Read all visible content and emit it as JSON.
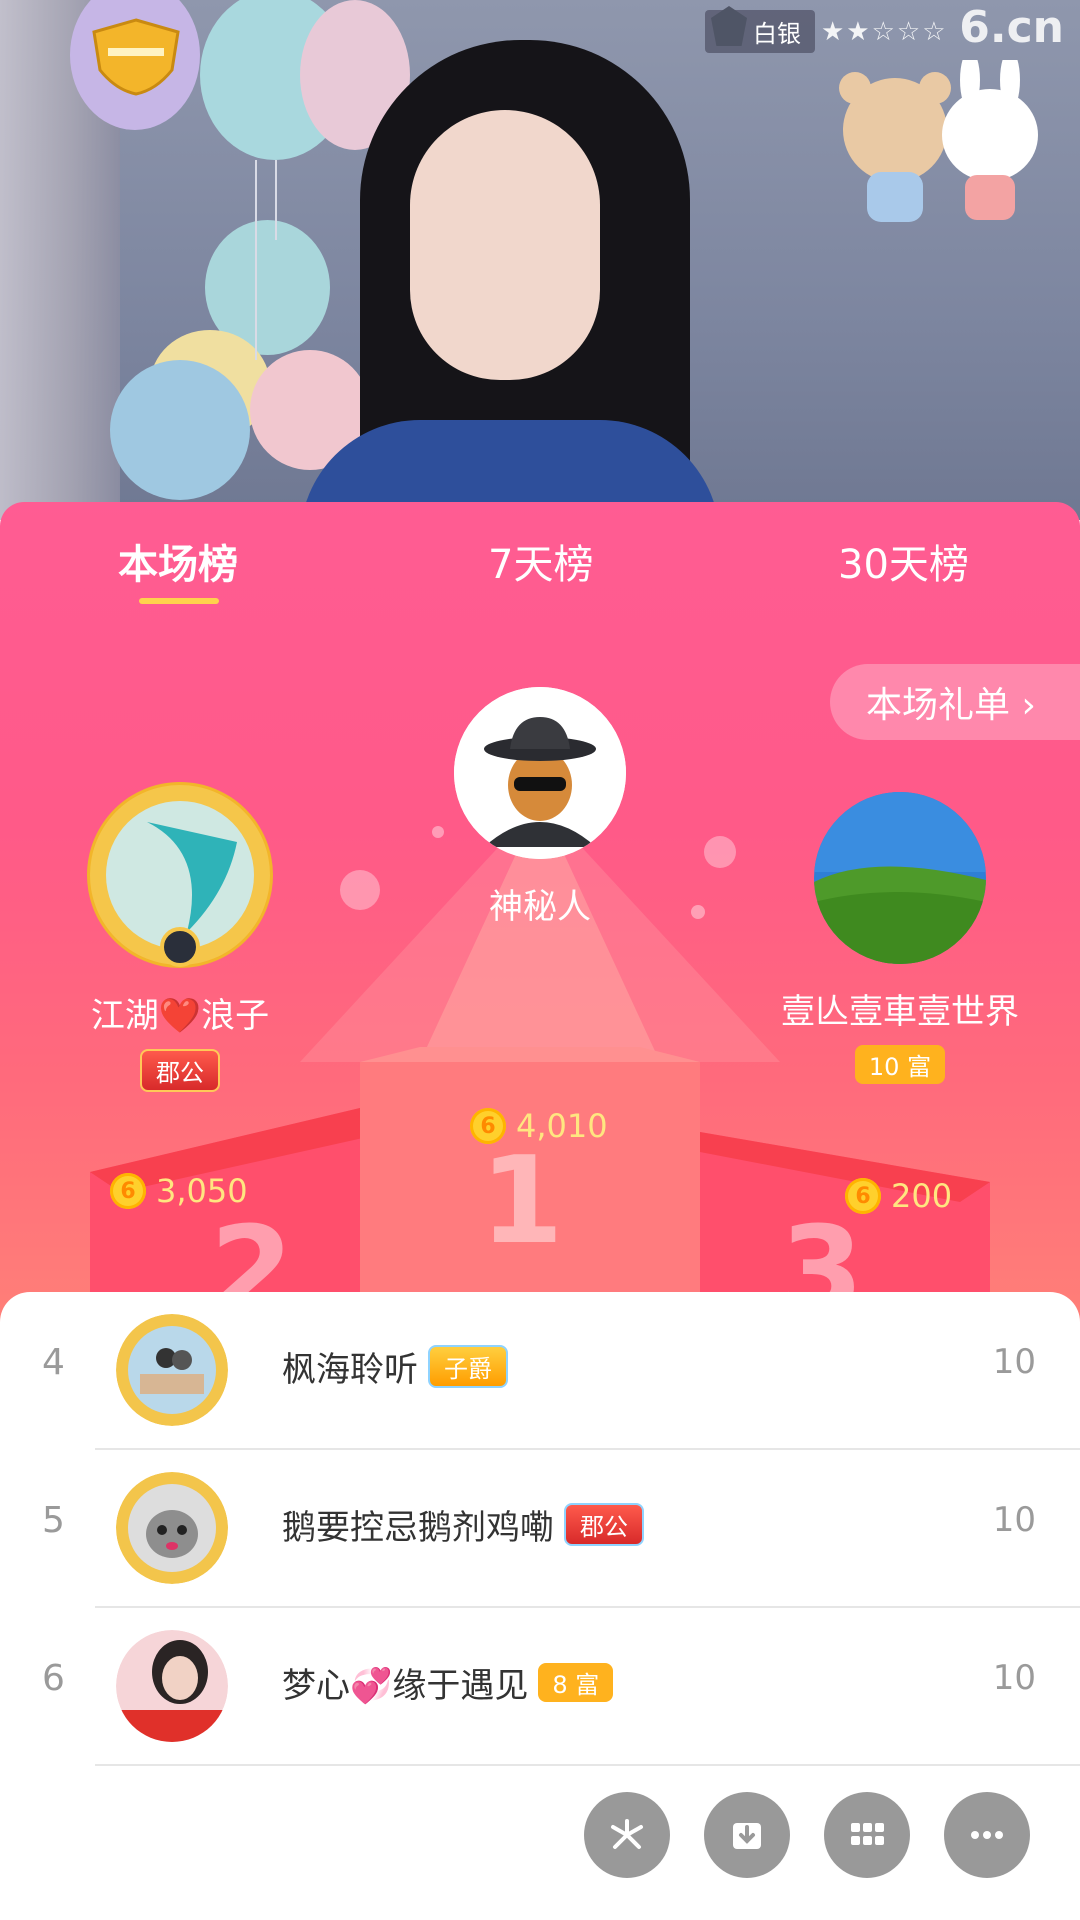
{
  "stream": {
    "rank_label": "白银",
    "stars": "★★☆☆☆",
    "logo_text": "6.cn"
  },
  "tabs": [
    {
      "label": "本场榜"
    },
    {
      "label": "7天榜"
    },
    {
      "label": "30天榜"
    }
  ],
  "gift_list_button": "本场礼单 ›",
  "podium": {
    "first": {
      "rank": 1,
      "name": "神秘人",
      "score": "4,010"
    },
    "second": {
      "rank": 2,
      "name": "江湖❤️浪子",
      "badge": "郡公",
      "score": "3,050"
    },
    "third": {
      "rank": 3,
      "name": "壹亾壹車壹世界",
      "badge": "10 富",
      "score": "200"
    }
  },
  "list": [
    {
      "rank": "4",
      "name": "枫海聆听",
      "badge": "子爵",
      "score": "10"
    },
    {
      "rank": "5",
      "name": "鹅要控忌鹅剂鸡嘞",
      "badge": "郡公",
      "score": "10"
    },
    {
      "rank": "6",
      "name": "梦心💞缘于遇见",
      "badge": "8 富",
      "score": "10"
    }
  ],
  "toolbar": [
    "share-icon",
    "download-icon",
    "grid-icon",
    "more-icon"
  ]
}
